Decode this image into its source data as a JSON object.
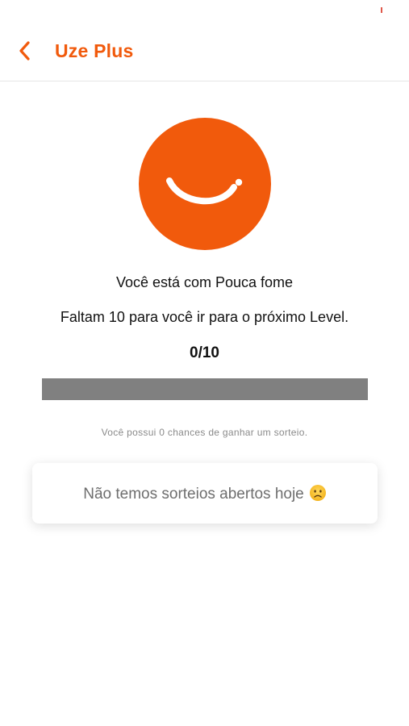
{
  "header": {
    "back_icon": "chevron-left-icon",
    "title": "Uze Plus"
  },
  "level": {
    "avatar_icon": "smile-face-icon",
    "status_text": "Você está com Pouca fome",
    "next_level_text": "Faltam 10 para você ir para o próximo Level.",
    "progress_label": "0/10",
    "progress_current": 0,
    "progress_total": 10,
    "chances_text": "Você possui 0 chances de ganhar um sorteio."
  },
  "raffle": {
    "message": "Não temos sorteios abertos hoje",
    "emoji_icon": "sad-face-emoji-icon"
  },
  "colors": {
    "accent": "#f15a0c",
    "progress_track": "#808080",
    "text_dark": "#111111",
    "text_muted": "#8a8a8a"
  }
}
